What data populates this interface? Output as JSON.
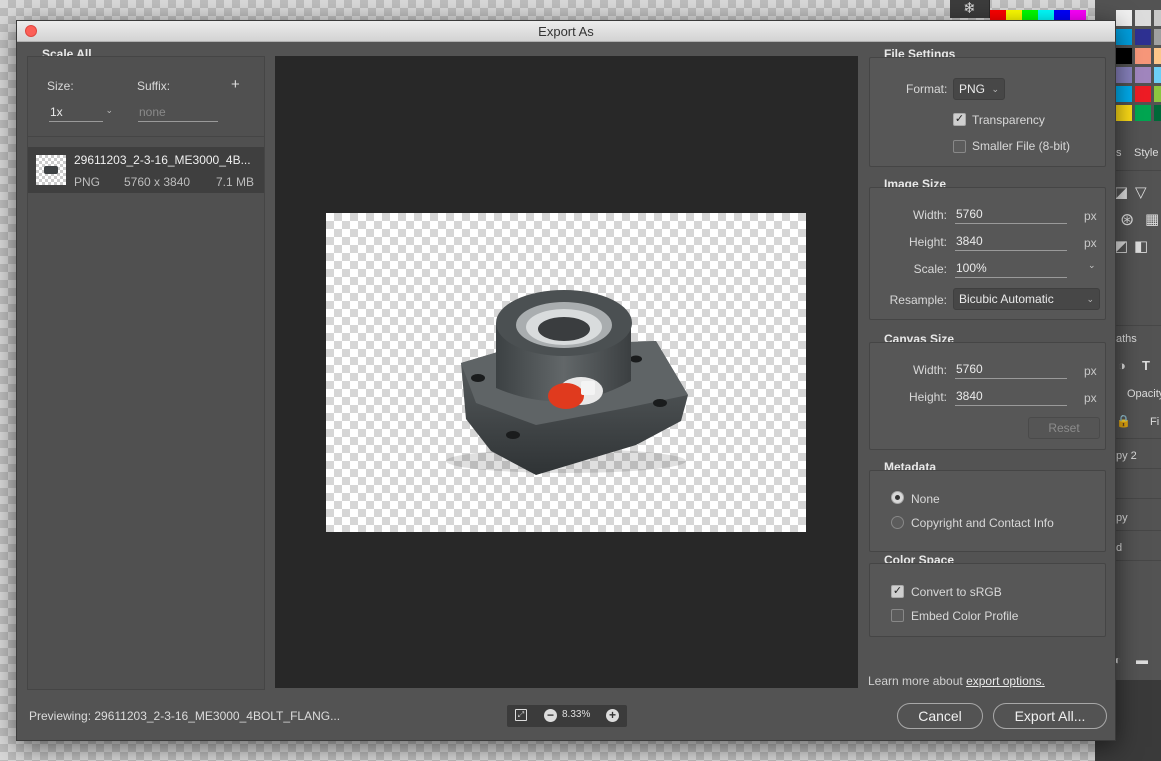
{
  "dialog": {
    "title": "Export As"
  },
  "scale_all": {
    "title": "Scale All",
    "size_label": "Size:",
    "suffix_label": "Suffix:",
    "add_symbol": "+",
    "size_value": "1x",
    "suffix_placeholder": "none"
  },
  "asset": {
    "name": "29611203_2-3-16_ME3000_4B...",
    "format": "PNG",
    "dimensions": "5760 x 3840",
    "size": "7.1 MB"
  },
  "file_settings": {
    "title": "File Settings",
    "format_label": "Format:",
    "format_value": "PNG",
    "transparency_label": "Transparency",
    "transparency_checked": true,
    "smaller_file_label": "Smaller File (8-bit)",
    "smaller_file_checked": false
  },
  "image_size": {
    "title": "Image Size",
    "width_label": "Width:",
    "width_value": "5760",
    "height_label": "Height:",
    "height_value": "3840",
    "scale_label": "Scale:",
    "scale_value": "100%",
    "resample_label": "Resample:",
    "resample_value": "Bicubic Automatic",
    "unit": "px"
  },
  "canvas_size": {
    "title": "Canvas Size",
    "width_label": "Width:",
    "width_value": "5760",
    "height_label": "Height:",
    "height_value": "3840",
    "unit": "px",
    "reset_label": "Reset"
  },
  "metadata": {
    "title": "Metadata",
    "none_label": "None",
    "copyright_label": "Copyright and Contact Info",
    "selected": "None"
  },
  "color_space": {
    "title": "Color Space",
    "convert_label": "Convert to sRGB",
    "convert_checked": true,
    "embed_label": "Embed Color Profile",
    "embed_checked": false
  },
  "footer": {
    "learn_more_prefix": "Learn more about ",
    "learn_more_link": "export options.",
    "previewing": "Previewing: 29611203_2-3-16_ME3000_4BOLT_FLANG...",
    "zoom": "8.33%",
    "cancel_label": "Cancel",
    "export_label": "Export All..."
  },
  "background_app": {
    "tabs": [
      "s",
      "Style",
      "aths"
    ],
    "labels": [
      "Opacity",
      "Fi",
      "py 2",
      "py",
      "d"
    ],
    "swatch_colors": [
      "#ff0000",
      "#ffff00",
      "#00ff00",
      "#00ffff",
      "#0000ff",
      "#ff00ff"
    ],
    "swatch_grid_colors": [
      "#f0f0f0",
      "#dcdcdc",
      "#c8c8c8",
      "#00a0e0",
      "#2e3192",
      "#a0a0a0",
      "#000000",
      "#f7977a",
      "#fdc68a",
      "#8882be",
      "#a186be",
      "#6dcff6",
      "#00aeef",
      "#ee1c25",
      "#8dc63f",
      "#ffde17",
      "#00a651",
      "#006838"
    ]
  }
}
